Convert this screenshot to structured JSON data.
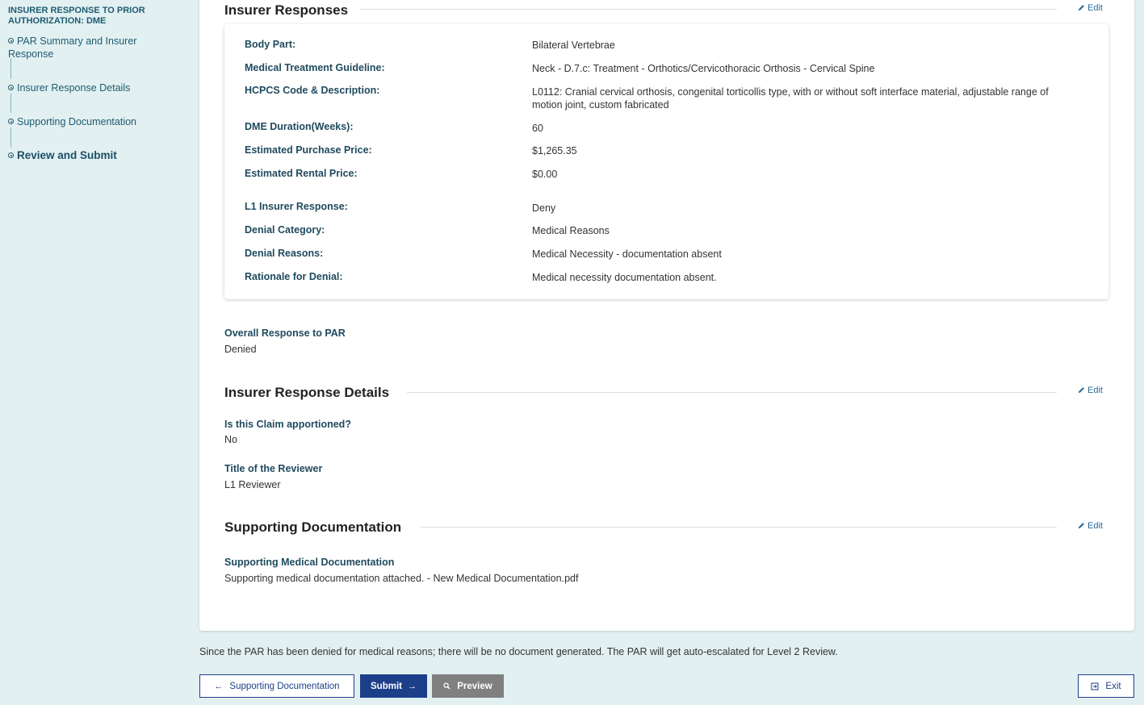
{
  "sidebar": {
    "heading": "INSURER RESPONSE TO PRIOR AUTHORIZATION: DME",
    "items": [
      {
        "label": "PAR Summary and Insurer Response"
      },
      {
        "label": "Insurer Response Details"
      },
      {
        "label": "Supporting Documentation"
      },
      {
        "label": "Review and Submit"
      }
    ]
  },
  "insurer_responses": {
    "title": "Insurer Responses",
    "edit_label": "Edit",
    "rows": [
      {
        "label": "Body Part:",
        "value": "Bilateral Vertebrae"
      },
      {
        "label": "Medical Treatment Guideline:",
        "value": "Neck - D.7.c: Treatment - Orthotics/Cervicothoracic Orthosis - Cervical Spine"
      },
      {
        "label": "HCPCS Code & Description:",
        "value": "L0112: Cranial cervical orthosis, congenital torticollis type, with or without soft interface material, adjustable range of motion joint, custom fabricated"
      },
      {
        "label": "DME Duration(Weeks):",
        "value": "60"
      },
      {
        "label": "Estimated Purchase Price:",
        "value": "$1,265.35"
      },
      {
        "label": "Estimated Rental Price:",
        "value": "$0.00"
      },
      {
        "label": "L1 Insurer Response:",
        "value": "Deny"
      },
      {
        "label": "Denial Category:",
        "value": "Medical Reasons"
      },
      {
        "label": "Denial Reasons:",
        "value": "Medical Necessity - documentation absent"
      },
      {
        "label": "Rationale for Denial:",
        "value": "Medical necessity documentation absent."
      }
    ],
    "overall_label": "Overall Response to PAR",
    "overall_value": "Denied"
  },
  "response_details": {
    "title": "Insurer Response Details",
    "edit_label": "Edit",
    "apportioned_label": "Is this Claim apportioned?",
    "apportioned_value": "No",
    "reviewer_label": "Title of the Reviewer",
    "reviewer_value": "L1 Reviewer"
  },
  "supporting_docs": {
    "title": "Supporting Documentation",
    "edit_label": "Edit",
    "field_label": "Supporting Medical Documentation",
    "field_value": "Supporting medical documentation attached. - New Medical Documentation.pdf"
  },
  "notice": "Since the PAR has been denied for medical reasons; there will be no document generated. The PAR will get auto-escalated for Level 2 Review.",
  "footer": {
    "back_label": "Supporting Documentation",
    "submit_label": "Submit",
    "preview_label": "Preview",
    "exit_label": "Exit"
  },
  "colors": {
    "background": "#e2f0f1",
    "primary": "#1d3f8a",
    "label": "#1f4a5e",
    "nav": "#1f5b73"
  }
}
